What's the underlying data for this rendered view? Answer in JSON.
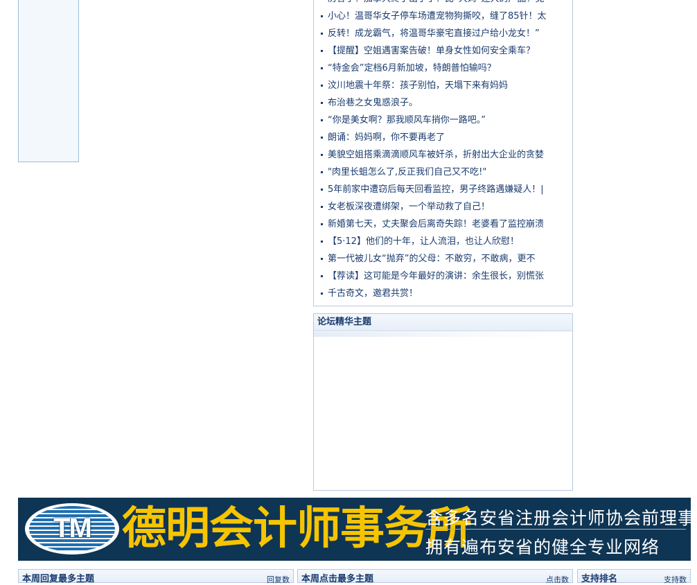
{
  "news": {
    "items": [
      "历各子！加拿大终于出手了！比“大妈”还大的产品！竟",
      "小心！温哥华女子停车场遭宠物狗撕咬，缝了85针！太",
      "反转！成龙霸气，将温哥华豪宅直接过户给小龙女！”",
      "【提醒】空姐遇害案告破！单身女性如何安全乘车？",
      "“特金会”定档6月新加坡，特朗普怕输吗？",
      "汶川地震十年祭：孩子别怕，天塌下来有妈妈",
      "布治巷之女鬼惑浪子。",
      "“你是美女啊？那我顺风车捎你一路吧。”",
      "朗诵：妈妈啊，你不要再老了",
      "美貌空姐搭乘滴滴顺风车被奸杀，折射出大企业的贪婪",
      "\"肉里长蛆怎么了,反正我们自己又不吃!\"",
      "5年前家中遭窃后每天回看监控，男子终路遇嫌疑人！|",
      "女老板深夜遭绑架，一个举动救了自己！",
      "新婚第七天，丈夫聚会后离奇失踪！老婆看了监控崩溃",
      "【5·12】他们的十年，让人流泪，也让人欣慰！",
      "第一代被儿女“抛弃”的父母：不敢穷，不敢病，更不",
      "【荐读】这可能是今年最好的演讲：余生很长，别慌张",
      "千古奇文，邀君共赏！"
    ]
  },
  "featured": {
    "title": "论坛精华主题"
  },
  "banner": {
    "logo_text": "TM",
    "name": "德明会计师事务所",
    "tagline1": "含多名安省注册会计师协会前理事",
    "tagline2": "拥有遍布安省的健全专业网络"
  },
  "bottom": {
    "panels": [
      {
        "title": "本周回复最多主题",
        "col": "回复数"
      },
      {
        "title": "本周点击最多主题",
        "col": "点击数"
      },
      {
        "title": "支持排名",
        "col": "支持数"
      }
    ]
  },
  "colors": {
    "link": "#1a3b6e",
    "border": "#b7c9de",
    "banner_bg": "#0f3554",
    "banner_name": "#f6c400"
  }
}
